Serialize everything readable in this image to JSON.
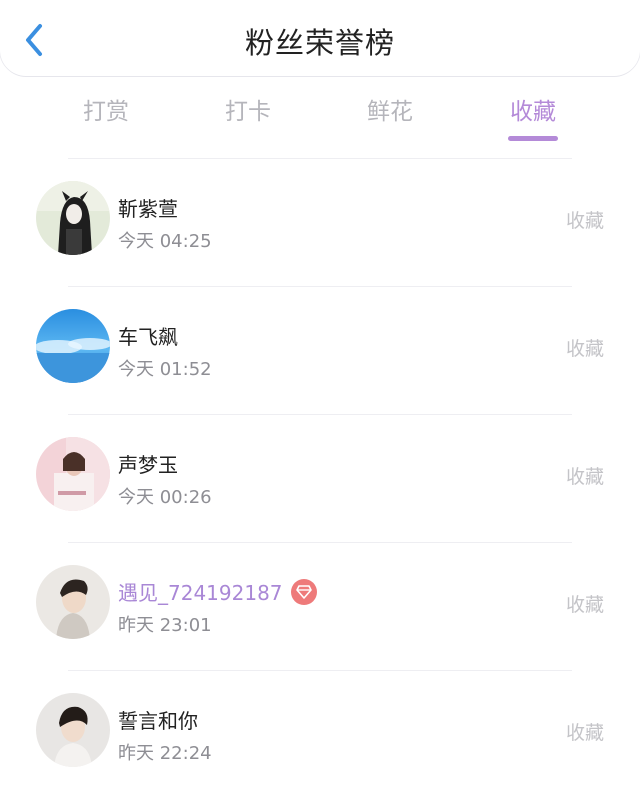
{
  "header": {
    "title": "粉丝荣誉榜",
    "back_icon": "chevron-left-icon"
  },
  "tabs": [
    {
      "label": "打赏",
      "active": false
    },
    {
      "label": "打卡",
      "active": false
    },
    {
      "label": "鲜花",
      "active": false
    },
    {
      "label": "收藏",
      "active": true
    }
  ],
  "colors": {
    "accent": "#b48ad8",
    "back": "#3b8fe0",
    "vip_badge": "#ee7a7a"
  },
  "fans": [
    {
      "name": "靳紫萱",
      "time": "今天 04:25",
      "tag": "收藏",
      "vip": false
    },
    {
      "name": "车飞飙",
      "time": "今天 01:52",
      "tag": "收藏",
      "vip": false
    },
    {
      "name": "声梦玉",
      "time": "今天 00:26",
      "tag": "收藏",
      "vip": false
    },
    {
      "name": "遇见_724192187",
      "time": "昨天 23:01",
      "tag": "收藏",
      "vip": true,
      "badge_icon": "diamond-icon"
    },
    {
      "name": "誓言和你",
      "time": "昨天 22:24",
      "tag": "收藏",
      "vip": false
    }
  ]
}
